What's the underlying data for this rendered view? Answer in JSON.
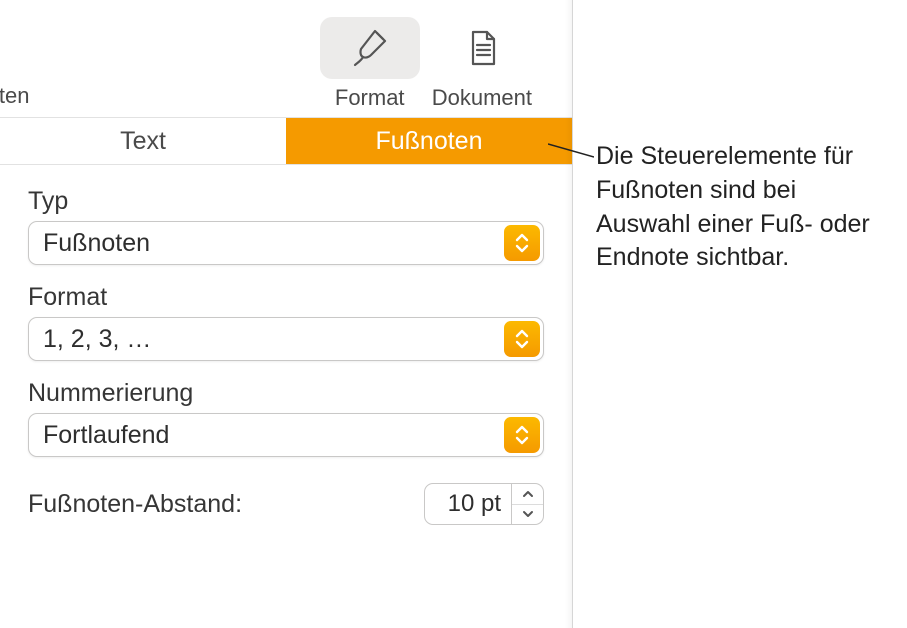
{
  "toolbar": {
    "left_label": "arbeiten",
    "format_label": "Format",
    "document_label": "Dokument"
  },
  "tabs": {
    "text": "Text",
    "footnotes": "Fußnoten"
  },
  "fields": {
    "type": {
      "label": "Typ",
      "value": "Fußnoten"
    },
    "format": {
      "label": "Format",
      "value": "1, 2, 3, …"
    },
    "numbering": {
      "label": "Nummerierung",
      "value": "Fortlaufend"
    },
    "spacing": {
      "label": "Fußnoten-Abstand:",
      "value": "10 pt"
    }
  },
  "callout": "Die Steuerelemente für Fußnoten sind bei Auswahl einer Fuß- oder Endnote sichtbar."
}
